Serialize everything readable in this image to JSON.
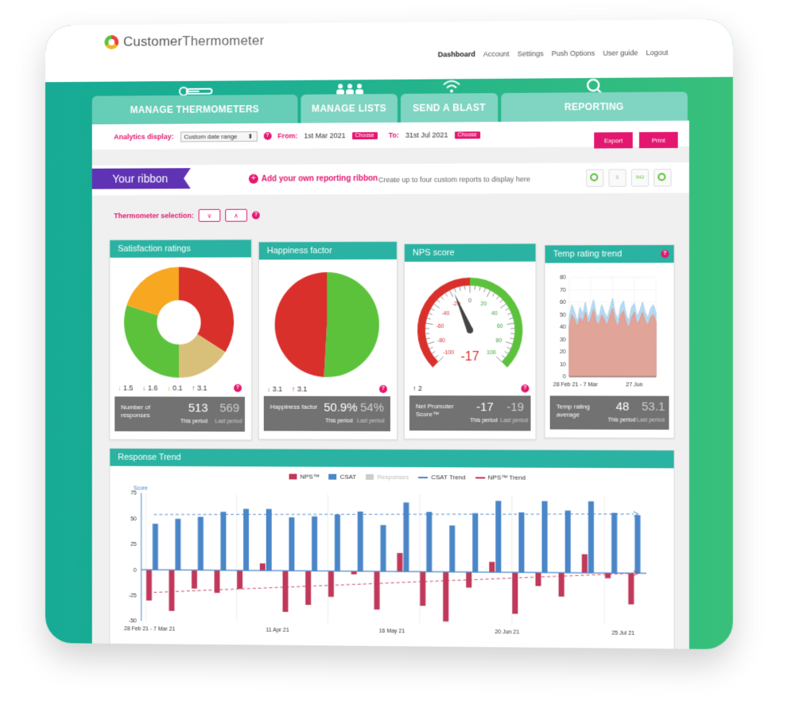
{
  "app": {
    "logo_word1": "Customer",
    "logo_word2": "Thermometer"
  },
  "nav": {
    "items": [
      "Dashboard",
      "Account",
      "Settings",
      "Push Options",
      "User guide",
      "Logout"
    ],
    "active": "Dashboard"
  },
  "tabs": [
    {
      "label": "MANAGE THERMOMETERS",
      "icon": "thermometer-icon"
    },
    {
      "label": "MANAGE LISTS",
      "icon": "users-icon"
    },
    {
      "label": "SEND A BLAST",
      "icon": "wifi-icon"
    },
    {
      "label": "REPORTING",
      "icon": "search-icon"
    }
  ],
  "analytics": {
    "label": "Analytics display:",
    "range": "Custom date range",
    "from_label": "From:",
    "from_value": "1st Mar 2021",
    "to_label": "To:",
    "to_value": "31st Jul 2021",
    "choose": "Choose",
    "export": "Export",
    "print": "Print"
  },
  "ribbon": {
    "label": "Your ribbon",
    "add": "Add your own reporting ribbon",
    "hint": "Create up to four custom reports to display here",
    "mini_value": "542"
  },
  "thermometer_selection": {
    "label": "Thermometer selection:"
  },
  "cards": {
    "satisfaction": {
      "title": "Satisfaction ratings",
      "deltas": [
        "1.5",
        "1.6",
        "0.1",
        "3.1"
      ],
      "stat_label": "Number of responses",
      "this_value": "513",
      "last_value": "569",
      "this_label": "This period",
      "last_label": "Last period"
    },
    "happiness": {
      "title": "Happiness factor",
      "deltas": [
        "3.1",
        "3.1"
      ],
      "stat_label": "Happiness factor",
      "this_value": "50.9%",
      "last_value": "54%",
      "this_label": "This period",
      "last_label": "Last period"
    },
    "nps": {
      "title": "NPS score",
      "delta": "2",
      "value_display": "-17",
      "gauge_labels": [
        "-100",
        "-80",
        "-60",
        "-40",
        "-20",
        "0",
        "20",
        "40",
        "60",
        "80",
        "100"
      ],
      "stat_label": "Net Promoter Score™",
      "this_value": "-17",
      "last_value": "-19",
      "this_label": "This period",
      "last_label": "Last period"
    },
    "temp": {
      "title": "Temp rating trend",
      "stat_label": "Temp rating average",
      "this_value": "48",
      "last_value": "53.1",
      "this_label": "This period",
      "last_label": "Last period",
      "x_labels": [
        "28 Feb 21 - 7 Mar",
        "27 Jun"
      ]
    }
  },
  "colors": {
    "teal": "#2ab3a2",
    "pink": "#e3176f",
    "nps": "#c0385a",
    "csat": "#4a86c8",
    "red": "#d9302c",
    "green": "#5cc23c",
    "orange": "#f7a820",
    "gold": "#d9c07a"
  },
  "trend": {
    "title": "Response Trend",
    "legend": [
      "NPS™",
      "CSAT",
      "Responses",
      "CSAT Trend",
      "NPS™ Trend"
    ],
    "ylabel": "Score"
  },
  "chart_data": [
    {
      "type": "pie",
      "title": "Satisfaction ratings",
      "donut": true,
      "slices": [
        {
          "name": "Red",
          "value": 34,
          "color": "#d9302c"
        },
        {
          "name": "Gold",
          "value": 16,
          "color": "#d9c07a"
        },
        {
          "name": "Green",
          "value": 30,
          "color": "#5cc23c"
        },
        {
          "name": "Orange",
          "value": 20,
          "color": "#f7a820"
        }
      ]
    },
    {
      "type": "pie",
      "title": "Happiness factor",
      "slices": [
        {
          "name": "Happy",
          "value": 50.9,
          "color": "#5cc23c"
        },
        {
          "name": "Unhappy",
          "value": 49.1,
          "color": "#d9302c"
        }
      ]
    },
    {
      "type": "gauge",
      "title": "NPS score",
      "value": -17,
      "range": [
        -100,
        100
      ]
    },
    {
      "type": "area",
      "title": "Temp rating trend",
      "ylim": [
        0,
        80
      ],
      "yticks": [
        0,
        10,
        20,
        30,
        40,
        50,
        60,
        70,
        80
      ],
      "series": [
        {
          "color": "#a9d2ef",
          "values": [
            48,
            58,
            52,
            44,
            56,
            50,
            60,
            46,
            54,
            62,
            50,
            48,
            58,
            52,
            47,
            55,
            63,
            51,
            46,
            57,
            61,
            50,
            45,
            56,
            59,
            48,
            53,
            60,
            52,
            47,
            55,
            58,
            51
          ]
        },
        {
          "color": "#e89a8a",
          "values": [
            40,
            50,
            46,
            40,
            48,
            44,
            52,
            42,
            47,
            54,
            44,
            42,
            50,
            46,
            41,
            49,
            55,
            45,
            40,
            50,
            53,
            44,
            39,
            48,
            52,
            42,
            46,
            52,
            45,
            41,
            48,
            50,
            44
          ]
        }
      ]
    },
    {
      "type": "bar",
      "title": "Response Trend",
      "ylabel": "Score",
      "ylim": [
        -50,
        75
      ],
      "yticks": [
        75,
        50,
        25,
        0,
        -25,
        -50
      ],
      "x_labels": [
        {
          "index": 0,
          "label": "28 Feb 21 - 7 Mar 21"
        },
        {
          "index": 6,
          "label": "11 Apr 21"
        },
        {
          "index": 11,
          "label": "16 May 21"
        },
        {
          "index": 16,
          "label": "20 Jun 21"
        },
        {
          "index": 21,
          "label": "25 Jul 21"
        }
      ],
      "series": [
        {
          "name": "CSAT",
          "color": "#4a86c8",
          "values": [
            45,
            50,
            52,
            57,
            60,
            60,
            52,
            53,
            55,
            58,
            45,
            67,
            58,
            45,
            57,
            69,
            58,
            69,
            60,
            69,
            58,
            56
          ]
        },
        {
          "name": "NPS™",
          "color": "#c0385a",
          "values": [
            -30,
            -40,
            -18,
            -22,
            -18,
            7,
            -40,
            -33,
            -25,
            -3,
            -37,
            18,
            -33,
            -48,
            -15,
            10,
            -40,
            -13,
            -23,
            18,
            -5,
            -30
          ]
        }
      ],
      "trend_lines": [
        {
          "name": "CSAT Trend",
          "from": 54,
          "to": 57
        },
        {
          "name": "NPS™ Trend",
          "from": -22,
          "to": 0
        }
      ]
    }
  ]
}
